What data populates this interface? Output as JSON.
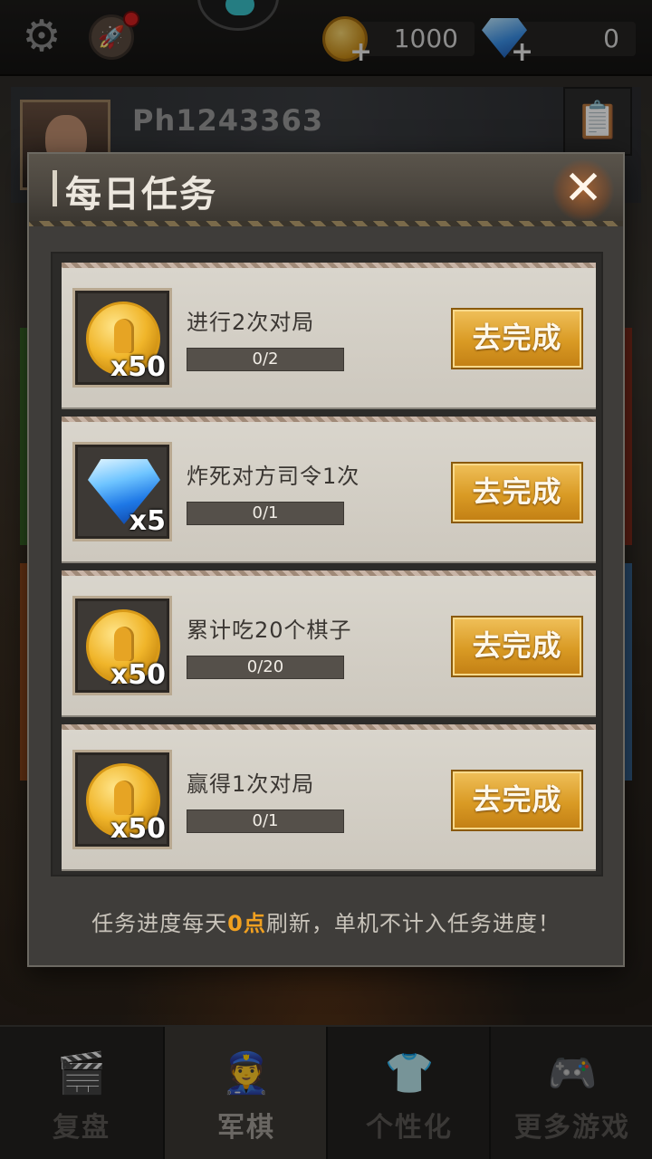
{
  "top_bar": {
    "coins": "1000",
    "gems": "0"
  },
  "profile": {
    "player_name": "Ph1243363"
  },
  "modal": {
    "title": "每日任务",
    "close_label": "✕",
    "tasks": [
      {
        "reward_type": "coin-icon",
        "reward_qty": "x50",
        "name": "进行2次对局",
        "progress": "0/2",
        "progress_fraction": 0,
        "action_label": "去完成"
      },
      {
        "reward_type": "gem-icon",
        "reward_qty": "x5",
        "name": "炸死对方司令1次",
        "progress": "0/1",
        "progress_fraction": 0,
        "action_label": "去完成"
      },
      {
        "reward_type": "coin-icon",
        "reward_qty": "x50",
        "name": "累计吃20个棋子",
        "progress": "0/20",
        "progress_fraction": 0,
        "action_label": "去完成"
      },
      {
        "reward_type": "coin-icon",
        "reward_qty": "x50",
        "name": "赢得1次对局",
        "progress": "0/1",
        "progress_fraction": 0,
        "action_label": "去完成"
      }
    ],
    "footer_note": {
      "before": "任务进度每天",
      "highlight": "0点",
      "after": "刷新，单机不计入任务进度！"
    }
  },
  "bottom_nav": {
    "items": [
      {
        "label": "复盘",
        "icon": "film-play-icon"
      },
      {
        "label": "军棋",
        "icon": "soldier-icon"
      },
      {
        "label": "个性化",
        "icon": "tshirt-icon"
      },
      {
        "label": "更多游戏",
        "icon": "gamepad-icon"
      }
    ],
    "active_index": 1
  },
  "colors": {
    "accent_gold": "#d99a24",
    "highlight_orange": "#f0a020",
    "modal_bg": "#3f3d3a",
    "card_bg": "#d9d5cc"
  }
}
